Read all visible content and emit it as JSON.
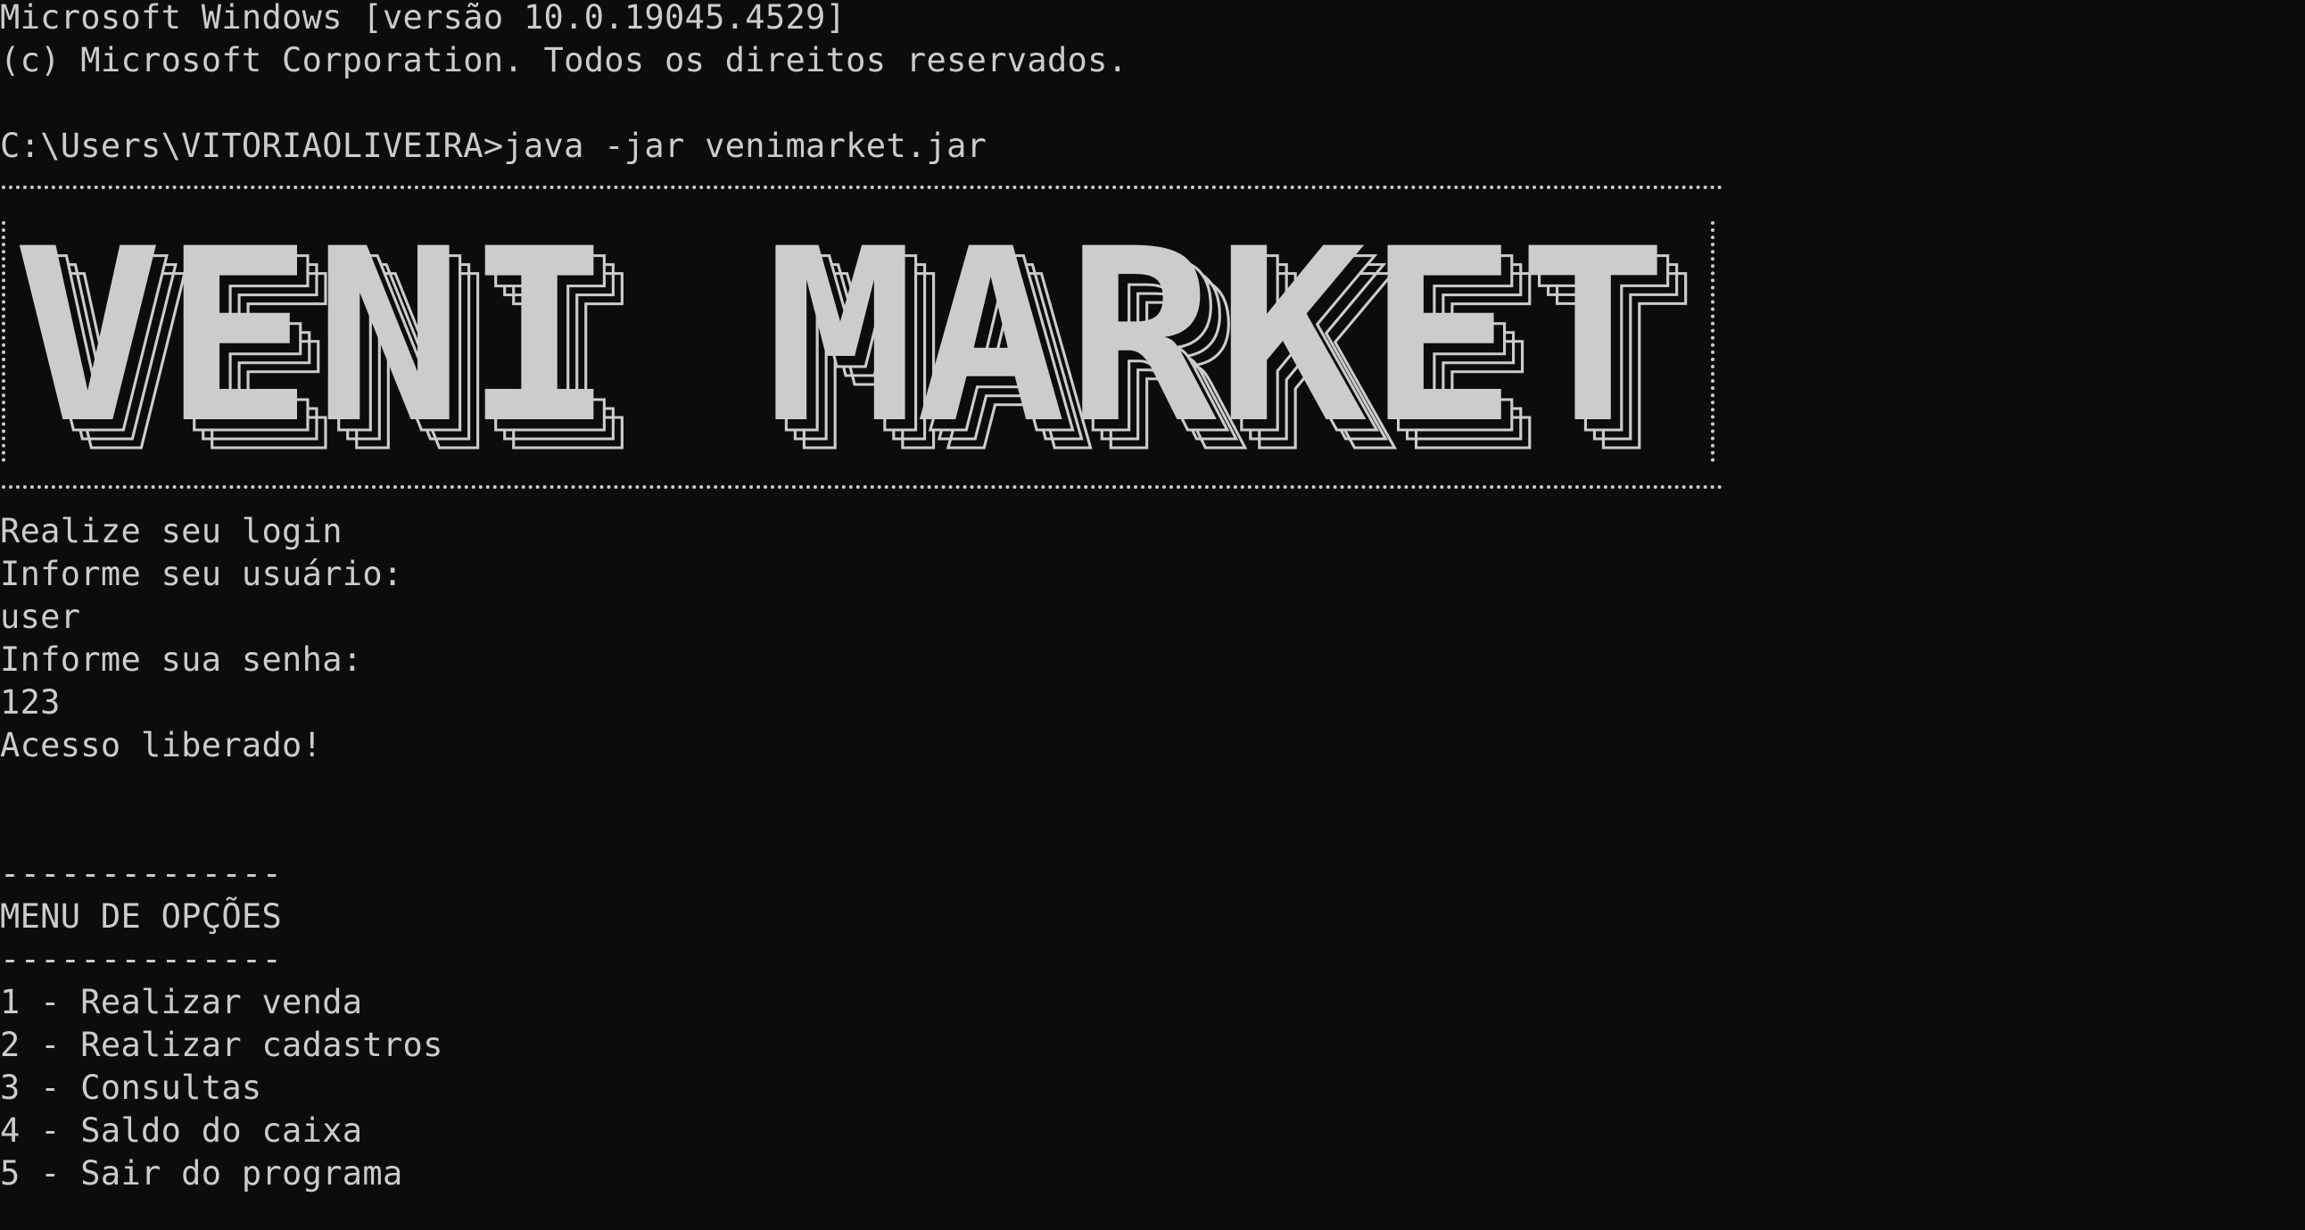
{
  "terminal": {
    "header_line_1": "Microsoft Windows [versão 10.0.19045.4529]",
    "header_line_2": "(c) Microsoft Corporation. Todos os direitos reservados.",
    "command_line": "C:\\Users\\VITORIAOLIVEIRA>java -jar venimarket.jar"
  },
  "banner": {
    "text": "VENI MARKET"
  },
  "login": {
    "prompt": "Realize seu login",
    "user_prompt": "Informe seu usuário:",
    "user_value": "user",
    "password_prompt": "Informe sua senha:",
    "password_value": "123",
    "result": "Acesso liberado!"
  },
  "menu": {
    "separator": "--------------",
    "title": "MENU DE OPÇÕES",
    "items": [
      "1 - Realizar venda",
      "2 - Realizar cadastros",
      "3 - Consultas",
      "4 - Saldo do caixa",
      "5 - Sair do programa"
    ]
  },
  "colors": {
    "background": "#0c0c0c",
    "foreground": "#cccccc"
  }
}
